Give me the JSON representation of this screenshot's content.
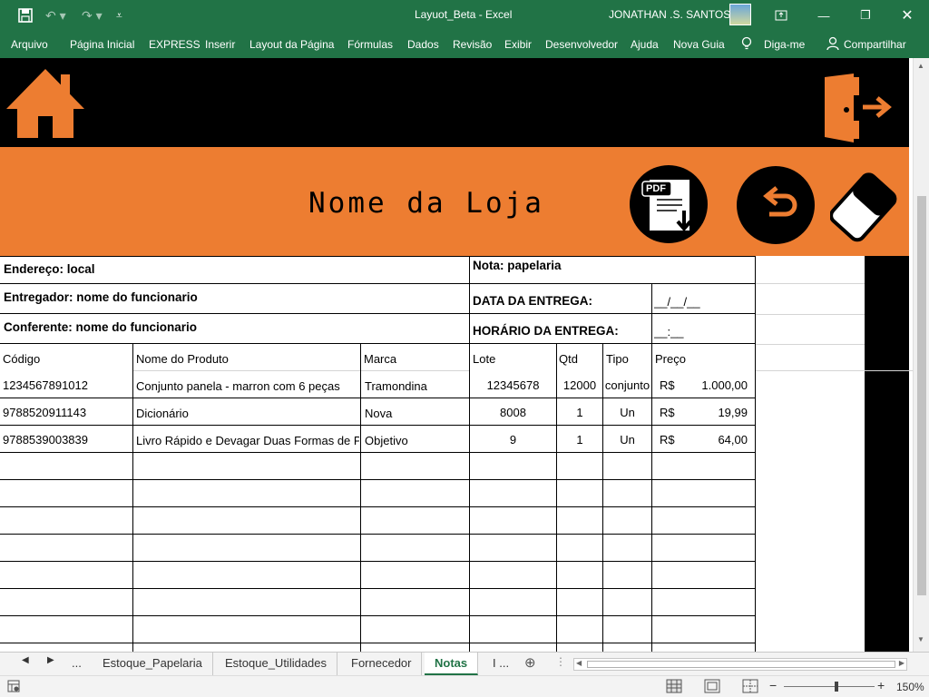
{
  "titlebar": {
    "doc_title": "Layuot_Beta  -  Excel",
    "user_name": "JONATHAN .S. SANTOS",
    "save_icon": "save-icon",
    "undo_icon": "undo-icon",
    "redo_icon": "redo-icon"
  },
  "ribbon": {
    "tabs": [
      "Arquivo",
      "Página Inicial",
      "EXPRESS",
      "Inserir",
      "Layout da Página",
      "Fórmulas",
      "Dados",
      "Revisão",
      "Exibir",
      "Desenvolvedor",
      "Ajuda",
      "Nova Guia"
    ],
    "tell_me": "Diga-me",
    "share": "Compartilhar"
  },
  "sheet": {
    "store_name": "Nome da Loja",
    "pdf_label": "PDF",
    "info": {
      "endereco": "Endereço: local",
      "nota": "Nota: papelaria",
      "entregador": "Entregador: nome do funcionario",
      "data_label": "DATA DA ENTREGA:",
      "data_value": "__/__/__",
      "conferente": "Conferente: nome do funcionario",
      "horario_label": "HORÁRIO DA ENTREGA:",
      "horario_value": "__:__"
    },
    "headers": [
      "Código",
      "Nome do Produto",
      "Marca",
      "Lote",
      "Qtd",
      "Tipo",
      "Preço"
    ],
    "rows": [
      {
        "codigo": "1234567891012",
        "nome": "Conjunto panela - marron com 6 peças",
        "marca": "Tramondina",
        "lote": "12345678",
        "qtd": "12000",
        "tipo": "conjunto",
        "moeda": "R$",
        "preco": "1.000,00"
      },
      {
        "codigo": "9788520911143",
        "nome": "Dicionário",
        "marca": "Nova",
        "lote": "8008",
        "qtd": "1",
        "tipo": "Un",
        "moeda": "R$",
        "preco": "19,99"
      },
      {
        "codigo": "9788539003839",
        "nome": "Livro Rápido e Devagar Duas Formas de Pensar",
        "marca": "Objetivo",
        "lote": "9",
        "qtd": "1",
        "tipo": "Un",
        "moeda": "R$",
        "preco": "64,00"
      }
    ]
  },
  "sheet_tabs": {
    "tabs": [
      "...",
      "Estoque_Papelaria",
      "Estoque_Utilidades",
      "Fornecedor",
      "Notas",
      "I ..."
    ],
    "active": "Notas"
  },
  "status": {
    "zoom": "150%",
    "zoom_level": 0.5
  },
  "colors": {
    "excel_green": "#217346",
    "banner_orange": "#ed7d31"
  }
}
